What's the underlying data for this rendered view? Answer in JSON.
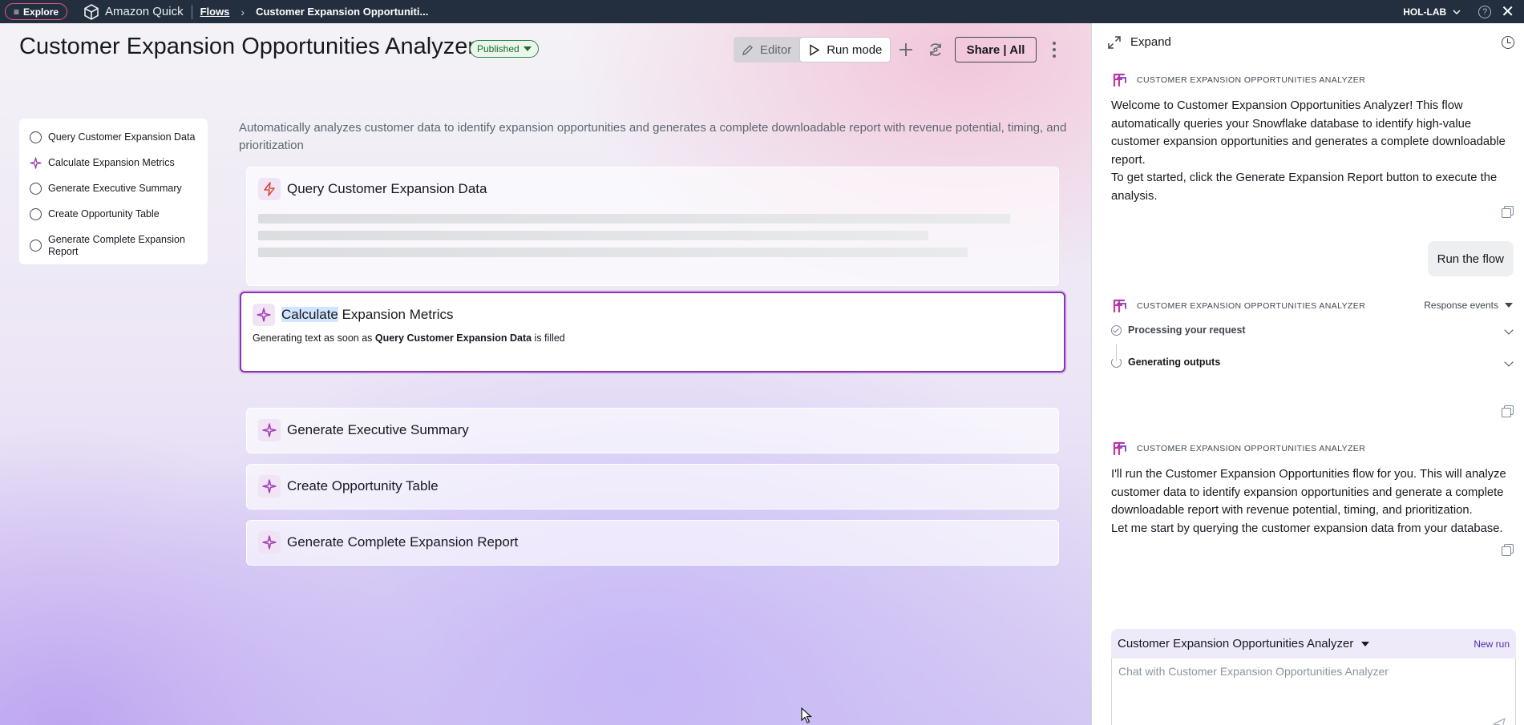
{
  "topbar": {
    "explore_label": "Explore",
    "brand": "Amazon Quick",
    "breadcrumb_link": "Flows",
    "breadcrumb_current": "Customer Expansion Opportuniti...",
    "account": "HOL-LAB",
    "help": "?"
  },
  "header": {
    "title": "Customer Expansion Opportunities Analyzer",
    "status": "Published",
    "editor_label": "Editor",
    "run_mode_label": "Run mode",
    "share_label": "Share | All"
  },
  "step_nav": {
    "items": [
      {
        "label": "Query Customer Expansion Data",
        "state": "empty"
      },
      {
        "label": "Calculate Expansion Metrics",
        "state": "active"
      },
      {
        "label": "Generate Executive Summary",
        "state": "empty"
      },
      {
        "label": "Create Opportunity Table",
        "state": "empty"
      },
      {
        "label": "Generate Complete Expansion Report",
        "state": "empty"
      }
    ]
  },
  "description": "Automatically analyzes customer data to identify expansion opportunities and generates a complete downloadable report with revenue potential, timing, and prioritization",
  "steps": {
    "query": {
      "title": "Query Customer Expansion Data"
    },
    "calculate": {
      "title_highlight": "Calculate",
      "title_rest": " Expansion Metrics",
      "status_prefix": "Generating text as soon as ",
      "status_dependency": "Query Customer Expansion Data",
      "status_suffix": " is filled"
    },
    "summary": {
      "title": "Generate Executive Summary"
    },
    "table": {
      "title": "Create Opportunity Table"
    },
    "report": {
      "title": "Generate Complete Expansion Report"
    }
  },
  "panel": {
    "expand_label": "Expand",
    "agent_name": "CUSTOMER EXPANSION OPPORTUNITIES ANALYZER",
    "welcome_text": "Welcome to Customer Expansion Opportunities Analyzer! This flow automatically queries your Snowflake database to identify high-value customer expansion opportunities and generates a complete downloadable report.",
    "welcome_text_2": "To get started, click the Generate Expansion Report button to execute the analysis.",
    "user_message": "Run the flow",
    "response_events_label": "Response events",
    "event_1": "Processing your request",
    "event_2": "Generating outputs",
    "reply_text": "I'll run the Customer Expansion Opportunities flow for you. This will analyze customer data to identify expansion opportunities and generate a complete downloadable report with revenue potential, timing, and prioritization.",
    "reply_text_2": "Let me start by querying the customer expansion data from your database.",
    "composer_agent": "Customer Expansion Opportunities Analyzer",
    "new_run_label": "New run",
    "composer_placeholder": "Chat with Customer Expansion Opportunities Analyzer"
  },
  "colors": {
    "topbar": "#232f3e",
    "accent_purple": "#8a33b0",
    "published_green": "#2e8540",
    "new_run_link": "#4b2db5"
  }
}
